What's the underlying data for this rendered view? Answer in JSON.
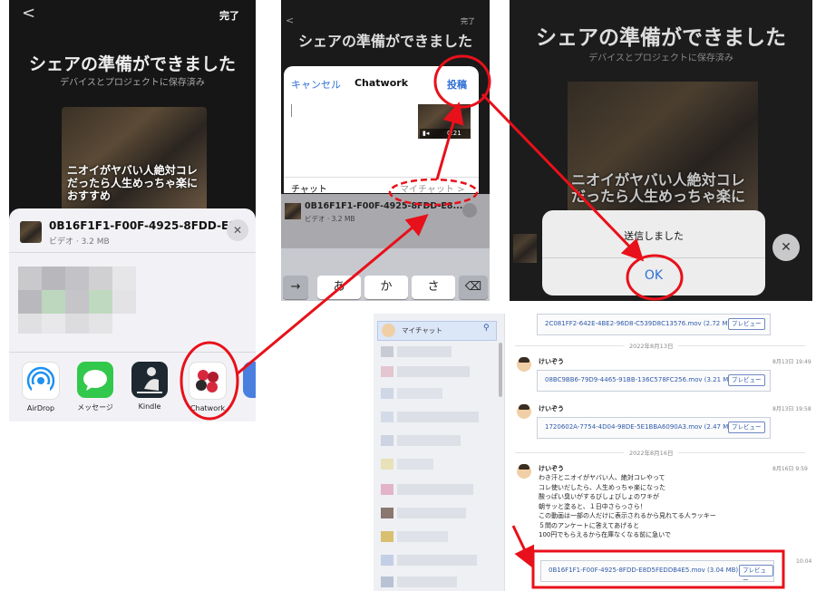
{
  "panel1": {
    "back": "<",
    "done": "完了",
    "title": "シェアの準備ができました",
    "subtitle": "デバイスとプロジェクトに保存済み",
    "thumb_text": "ニオイがヤバい人絶対コレ\nだったら人生めっちゃ楽に\nおすすめ",
    "file_name": "0B16F1F1-F00F-4925-8FDD-E8...",
    "file_meta": "ビデオ · 3.2 MB",
    "close": "✕",
    "apps": [
      {
        "label": "AirDrop",
        "icon": "airdrop-icon"
      },
      {
        "label": "メッセージ",
        "icon": "messages-icon"
      },
      {
        "label": "Kindle",
        "icon": "kindle-icon"
      },
      {
        "label": "Chatwork",
        "icon": "chatwork-icon"
      }
    ]
  },
  "panel2": {
    "back": "<",
    "done": "完了",
    "title": "シェアの準備ができました",
    "cancel": "キャンセル",
    "dialog_title": "Chatwork",
    "post": "投稿",
    "duration": "0:21",
    "chat_label": "チャット",
    "chat_value": "マイチャット >",
    "file_name": "0B16F1F1-F00F-4925-8FDD-E8...",
    "file_meta": "ビデオ · 3.2 MB",
    "keys": [
      "→",
      "あ",
      "か",
      "さ",
      "⌫"
    ]
  },
  "panel3": {
    "title": "シェアの準備ができました",
    "subtitle": "デバイスとプロジェクトに保存済み",
    "alert_message": "送信しました",
    "ok": "OK",
    "close": "✕"
  },
  "panel4": {
    "sidebar_mychat": "マイチャット",
    "files": [
      {
        "name": "2C081FF2-642E-4BE2-96D8-C539D8C13576.mov (2.72 MB)",
        "preview": "プレビュー"
      },
      {
        "name": "08BC9BB6-79D9-4465-91BB-136C578FC256.mov (3.21 MB)",
        "preview": "プレビュー"
      },
      {
        "name": "1720602A-7754-4D04-98DE-5E1BBA6090A3.mov (2.47 MB)",
        "preview": "プレビュー"
      },
      {
        "name": "0B16F1F1-F00F-4925-8FDD-E8D5FEDDB4E5.mov (3.04 MB)",
        "preview": "プレビュー"
      }
    ],
    "dates": [
      "2022年8月13日",
      "2022年8月16日"
    ],
    "messages": [
      {
        "user": "けいぞう",
        "time": "8月13日 19:49"
      },
      {
        "user": "けいぞう",
        "time": "8月13日 19:58"
      },
      {
        "user": "けいぞう",
        "time": "8月16日 9:59"
      }
    ],
    "message_lines": [
      "わき汗とニオイがヤバい人、絶対コレやって",
      "コレ使いだしたら、人生めっちゃ楽になった",
      "酸っぱい臭いがするびしょびしょのワキが",
      "朝サッと塗ると、１日中さらっさら！",
      "この動画は一部の人だけに表示されるから見れてる人ラッキー",
      "５問のアンケートに答えてあげると",
      "100円でもらえるから在庫なくなる前に急いで"
    ],
    "last_time": "10:04"
  },
  "colors": {
    "annotation_red": "#e8101a",
    "ios_blue": "#2e6fd6",
    "chatwork_red": "#d8283e"
  }
}
